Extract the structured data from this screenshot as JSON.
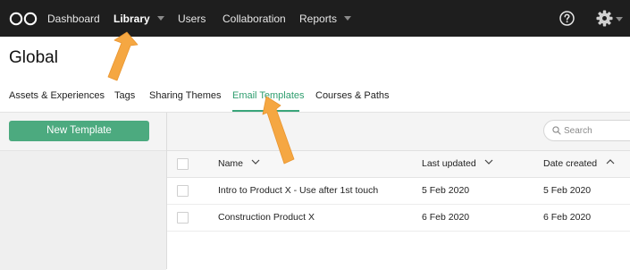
{
  "nav": {
    "items": [
      {
        "label": "Dashboard"
      },
      {
        "label": "Library"
      },
      {
        "label": "Users"
      },
      {
        "label": "Collaboration"
      },
      {
        "label": "Reports"
      }
    ],
    "active": "Library"
  },
  "page": {
    "title": "Global"
  },
  "tabs": [
    {
      "label": "Assets & Experiences"
    },
    {
      "label": "Tags"
    },
    {
      "label": "Sharing Themes"
    },
    {
      "label": "Email Templates"
    },
    {
      "label": "Courses & Paths"
    }
  ],
  "active_tab": "Email Templates",
  "sidebar": {
    "new_button_label": "New Template"
  },
  "search": {
    "placeholder": "Search",
    "value": ""
  },
  "table": {
    "columns": [
      {
        "label": "Name",
        "sort": "desc-icon"
      },
      {
        "label": "Last updated",
        "sort": "desc-icon"
      },
      {
        "label": "Date created",
        "sort": "asc-icon"
      }
    ],
    "rows": [
      {
        "name": "Intro to Product X - Use after 1st touch",
        "last_updated": "5 Feb 2020",
        "date_created": "5 Feb 2020"
      },
      {
        "name": "Construction Product X",
        "last_updated": "6 Feb 2020",
        "date_created": "6 Feb 2020"
      }
    ]
  },
  "colors": {
    "topbar": "#1e1e1e",
    "accent_green": "#3aa57a",
    "button_green": "#4caa7f",
    "annotation_arrow": "#f5a742"
  }
}
